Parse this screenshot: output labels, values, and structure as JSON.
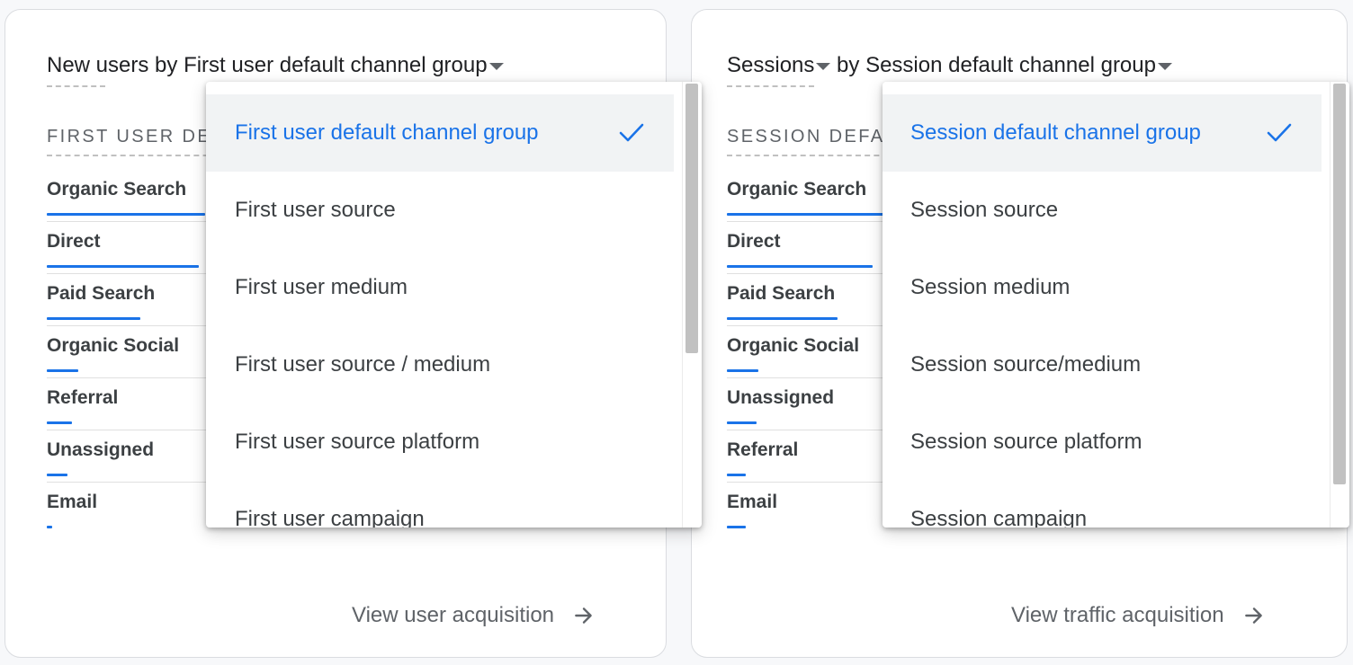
{
  "colors": {
    "accent": "#1a73e8",
    "text_primary": "#202124",
    "text_secondary": "#5f6368",
    "selected_bg": "#f1f3f4"
  },
  "left_card": {
    "title_metric": "New users",
    "title_by": " by ",
    "title_dimension": "First user default channel group",
    "column_header": "FIRST USER DEFAULT CHANNEL GROUP",
    "rows": [
      {
        "label": "Organic Search",
        "bar_fraction": 1.0
      },
      {
        "label": "Direct",
        "bar_fraction": 0.96
      },
      {
        "label": "Paid Search",
        "bar_fraction": 0.59
      },
      {
        "label": "Organic Social",
        "bar_fraction": 0.2
      },
      {
        "label": "Referral",
        "bar_fraction": 0.16
      },
      {
        "label": "Unassigned",
        "bar_fraction": 0.13
      },
      {
        "label": "Email",
        "bar_fraction": 0.03
      }
    ],
    "footer_link": "View user acquisition",
    "footer_icon": "arrow-right-icon"
  },
  "right_card": {
    "title_metric": "Sessions",
    "title_by": " by ",
    "title_dimension": "Session default channel group",
    "column_header": "SESSION DEFAULT CHANNEL GROUP",
    "rows": [
      {
        "label": "Organic Search",
        "bar_fraction": 1.0
      },
      {
        "label": "Direct",
        "bar_fraction": 0.92
      },
      {
        "label": "Paid Search",
        "bar_fraction": 0.7
      },
      {
        "label": "Organic Social",
        "bar_fraction": 0.2
      },
      {
        "label": "Unassigned",
        "bar_fraction": 0.19
      },
      {
        "label": "Referral",
        "bar_fraction": 0.12
      },
      {
        "label": "Email",
        "bar_fraction": 0.12
      }
    ],
    "footer_link": "View traffic acquisition",
    "footer_icon": "arrow-right-icon"
  },
  "left_dropdown": {
    "items": [
      {
        "label": "First user default channel group",
        "selected": true
      },
      {
        "label": "First user source",
        "selected": false
      },
      {
        "label": "First user medium",
        "selected": false
      },
      {
        "label": "First user source / medium",
        "selected": false
      },
      {
        "label": "First user source platform",
        "selected": false
      },
      {
        "label": "First user campaign",
        "selected": false
      }
    ],
    "check_icon": "check-icon"
  },
  "right_dropdown": {
    "items": [
      {
        "label": "Session default channel group",
        "selected": true
      },
      {
        "label": "Session source",
        "selected": false
      },
      {
        "label": "Session medium",
        "selected": false
      },
      {
        "label": "Session source/medium",
        "selected": false
      },
      {
        "label": "Session source platform",
        "selected": false
      },
      {
        "label": "Session campaign",
        "selected": false
      }
    ],
    "check_icon": "check-icon"
  }
}
